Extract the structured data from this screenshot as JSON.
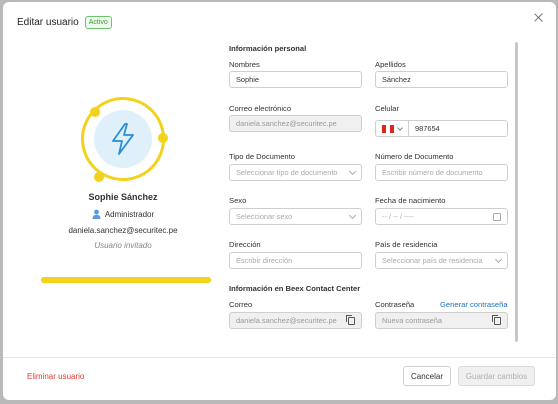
{
  "modal": {
    "title": "Editar usuario",
    "status_badge": "Activo"
  },
  "profile": {
    "name": "Sophie Sánchez",
    "role": "Administrador",
    "email": "daniela.sanchez@securitec.pe",
    "status": "Usuario invitado"
  },
  "form": {
    "personal_title": "Información personal",
    "nombres_label": "Nombres",
    "nombres_value": "Sophie",
    "apellidos_label": "Apellidos",
    "apellidos_value": "Sánchez",
    "correo_label": "Correo electrónico",
    "correo_value": "daniela.sanchez@securitec.pe",
    "celular_label": "Celular",
    "celular_value": "987654",
    "tipo_doc_label": "Tipo de Documento",
    "tipo_doc_placeholder": "Seleccionar tipo de documento",
    "num_doc_label": "Número de Documento",
    "num_doc_placeholder": "Escribir número de documento",
    "sexo_label": "Sexo",
    "sexo_placeholder": "Seleccionar sexo",
    "fecha_label": "Fecha de nacimiento",
    "fecha_placeholder": "-- / -- / ----",
    "direccion_label": "Dirección",
    "direccion_placeholder": "Escribir dirección",
    "pais_label": "País de residencia",
    "pais_placeholder": "Seleccionar país de residencia",
    "beex_title": "Información en Beex Contact Center",
    "beex_correo_label": "Correo",
    "beex_correo_value": "daniela.sanchez@securitec.pe",
    "contrasena_label": "Contraseña",
    "generar_link": "Generar contraseña",
    "contrasena_placeholder": "Nueva contraseña"
  },
  "footer": {
    "delete_label": "Eliminar usuario",
    "cancel_label": "Cancelar",
    "save_label": "Guardar cambios"
  },
  "colors": {
    "accent_yellow": "#f2d21b",
    "danger_red": "#e53935",
    "link_blue": "#1a73c8",
    "active_green": "#3b9a3b"
  },
  "icons": [
    "close-icon",
    "lightning-bolt-icon",
    "user-icon",
    "peru-flag-icon",
    "chevron-down-icon",
    "calendar-icon",
    "copy-icon"
  ]
}
